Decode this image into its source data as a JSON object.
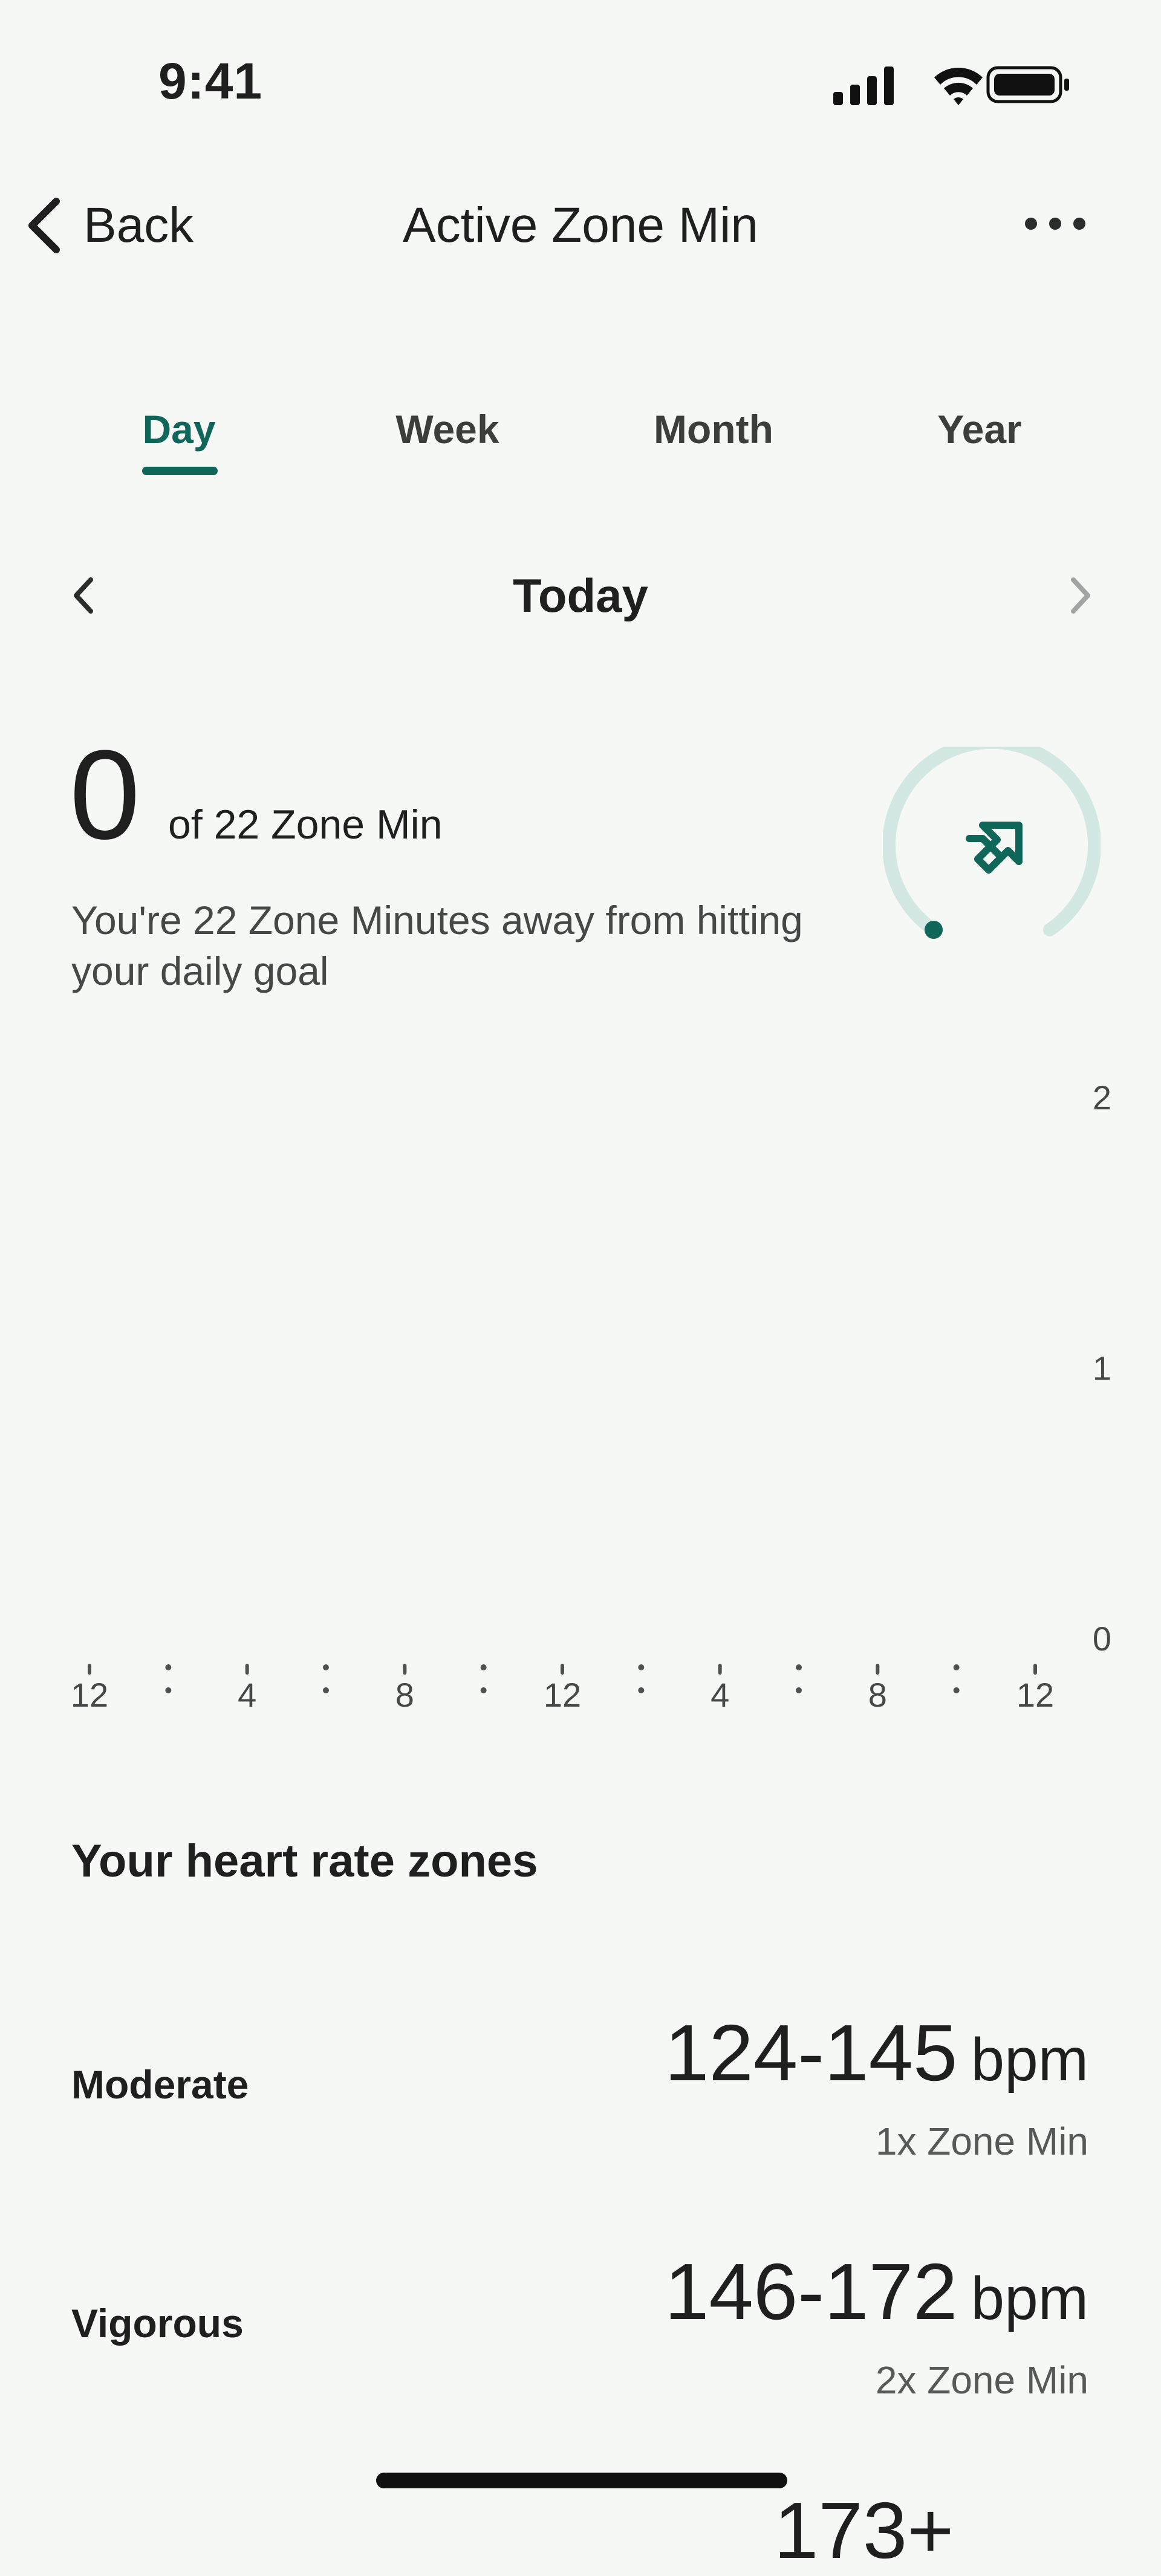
{
  "status_bar": {
    "time": "9:41"
  },
  "nav": {
    "back_label": "Back",
    "title": "Active Zone Min"
  },
  "tabs": [
    {
      "label": "Day",
      "active": true
    },
    {
      "label": "Week",
      "active": false
    },
    {
      "label": "Month",
      "active": false
    },
    {
      "label": "Year",
      "active": false
    }
  ],
  "date_nav": {
    "label": "Today"
  },
  "summary": {
    "value": "0",
    "goal_text": "of 22 Zone Min",
    "description": "You're 22 Zone Minutes away from hitting your daily goal",
    "progress_fraction": 0
  },
  "chart_data": {
    "type": "bar",
    "title": "",
    "x_tick_labels": [
      "12",
      "4",
      "8",
      "12",
      "4",
      "8",
      "12"
    ],
    "y_tick_labels": [
      "2",
      "1",
      "0"
    ],
    "ylim": [
      0,
      2
    ],
    "values": []
  },
  "heart_rate_zones": {
    "title": "Your heart rate zones",
    "zones": [
      {
        "name": "Moderate",
        "range": "124-145",
        "unit": "bpm",
        "multiplier": "1x Zone Min"
      },
      {
        "name": "Vigorous",
        "range": "146-172",
        "unit": "bpm",
        "multiplier": "2x Zone Min"
      }
    ],
    "partial_next_range": "173+"
  },
  "colors": {
    "accent": "#11665a",
    "gauge_track": "#d3e8e2",
    "background": "#f6f8f6"
  }
}
